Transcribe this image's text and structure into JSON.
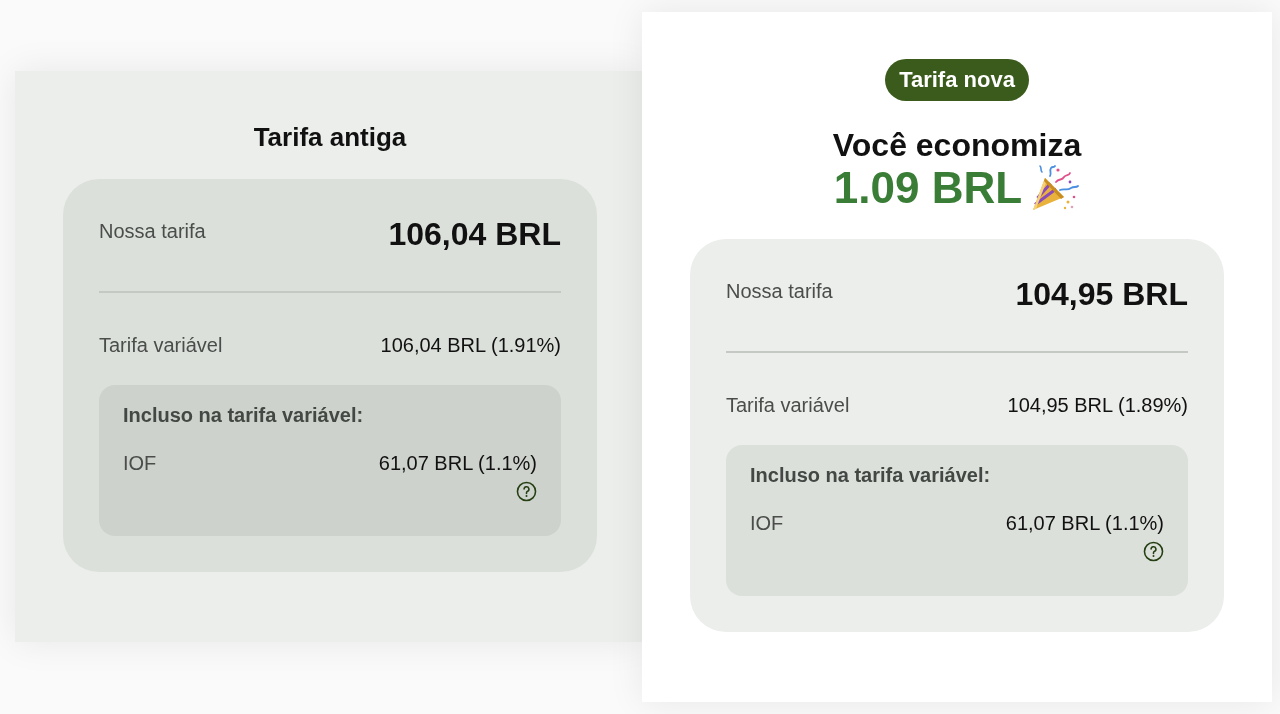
{
  "panels": [
    {
      "kind": "old",
      "title": "Tarifa antiga",
      "fee_card": {
        "main": {
          "label": "Nossa tarifa",
          "value": "106,04 BRL"
        },
        "variable": {
          "label": "Tarifa variável",
          "value": "106,04 BRL (1.91%)"
        },
        "included": {
          "heading": "Incluso na tarifa variável:",
          "items": [
            {
              "label": "IOF",
              "value": "61,07 BRL (1.1%)"
            }
          ]
        }
      }
    },
    {
      "kind": "new",
      "badge": "Tarifa nova",
      "headline": "Você economiza",
      "savings": "1.09 BRL",
      "fee_card": {
        "main": {
          "label": "Nossa tarifa",
          "value": "104,95 BRL"
        },
        "variable": {
          "label": "Tarifa variável",
          "value": "104,95 BRL (1.89%)"
        },
        "included": {
          "heading": "Incluso na tarifa variável:",
          "items": [
            {
              "label": "IOF",
              "value": "61,07 BRL (1.1%)"
            }
          ]
        }
      }
    }
  ]
}
